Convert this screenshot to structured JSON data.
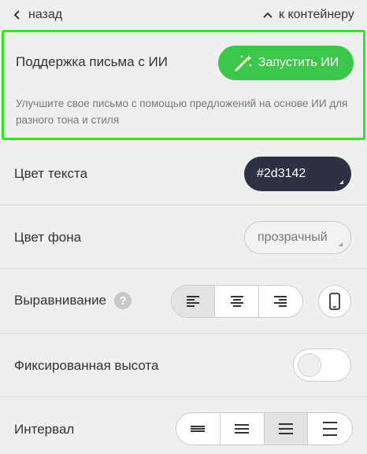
{
  "nav": {
    "back_label": "назад",
    "container_label": "к контейнеру"
  },
  "ai": {
    "title": "Поддержка письма с ИИ",
    "button_label": "Запустить ИИ",
    "description": "Улучшите свое письмо с помощью предложений на основе ИИ для разного тона и стиля",
    "accent": "#3cc64a",
    "highlight": "#2ee81f"
  },
  "text_color": {
    "label": "Цвет текста",
    "value": "#2d3142"
  },
  "bg_color": {
    "label": "Цвет фона",
    "value": "прозрачный"
  },
  "alignment": {
    "label": "Выравнивание",
    "help": "?",
    "options": [
      "align-left-icon",
      "align-center-icon",
      "align-right-icon"
    ],
    "selected": 0
  },
  "fixed_height": {
    "label": "Фиксированная высота",
    "enabled": false
  },
  "spacing": {
    "label": "Интервал",
    "options": [
      "spacing-tight-icon",
      "spacing-small-icon",
      "spacing-medium-icon",
      "spacing-large-icon"
    ],
    "selected": 2
  }
}
